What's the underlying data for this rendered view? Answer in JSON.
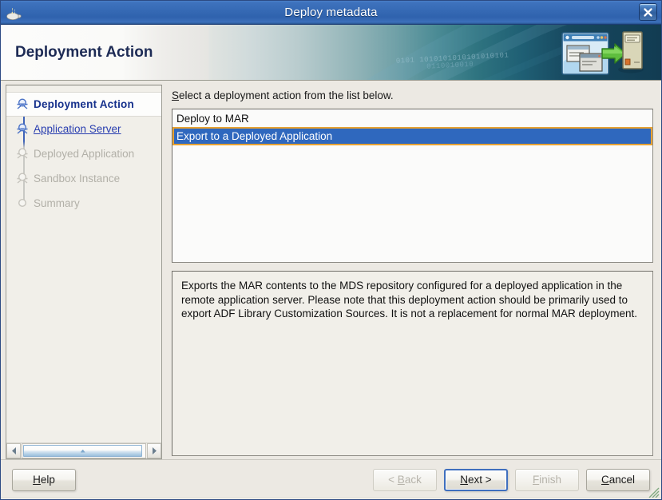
{
  "window": {
    "title": "Deploy metadata",
    "app_icon": "java-coffee-cup-icon",
    "close_label": "✕"
  },
  "banner": {
    "title": "Deployment Action",
    "bits_line1": "0101 1010101010101010101",
    "bits_line2": "0110010010",
    "icon": "deploy-to-server-icon"
  },
  "sidebar": {
    "items": [
      {
        "label": "Deployment Action",
        "state": "current"
      },
      {
        "label": "Application Server",
        "state": "link"
      },
      {
        "label": "Deployed Application",
        "state": "disabled"
      },
      {
        "label": "Sandbox Instance",
        "state": "disabled"
      },
      {
        "label": "Summary",
        "state": "disabled"
      }
    ],
    "scroll_left": "◄",
    "scroll_right": "►"
  },
  "content": {
    "prompt_mnemonic": "S",
    "prompt_rest": "elect a deployment action from the list below.",
    "options": [
      {
        "label": "Deploy to MAR",
        "selected": false
      },
      {
        "label": "Export to a Deployed Application",
        "selected": true
      }
    ],
    "description": "Exports the MAR contents to the MDS repository configured for a deployed application in the remote application server. Please note that this deployment action should be primarily used to export ADF Library Customization Sources. It is not a replacement for normal MAR deployment."
  },
  "footer": {
    "help": {
      "mn": "H",
      "rest": "elp",
      "disabled": false
    },
    "back": {
      "pre": "< ",
      "mn": "B",
      "rest": "ack",
      "disabled": true
    },
    "next": {
      "mn": "N",
      "rest": "ext >",
      "disabled": false,
      "default": true
    },
    "finish": {
      "mn": "F",
      "rest": "inish",
      "disabled": true
    },
    "cancel": {
      "mn": "C",
      "rest": "ancel",
      "disabled": false
    }
  },
  "colors": {
    "titlebar_blue": "#3569b4",
    "selection_blue": "#2f68be",
    "focus_orange": "#e8a233",
    "link_blue": "#2a3fb0",
    "current_navy": "#15308c",
    "disabled_gray": "#b2b0a8"
  }
}
